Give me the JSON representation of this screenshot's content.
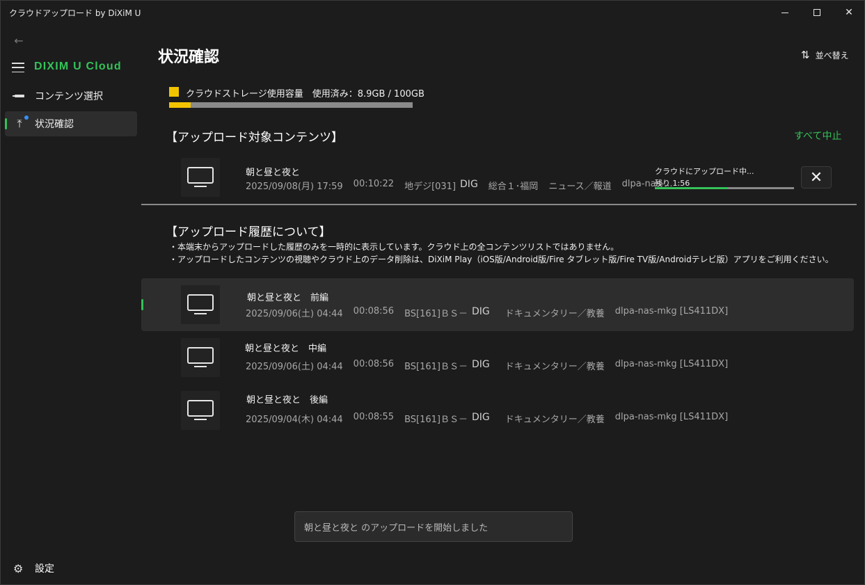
{
  "window": {
    "title": "クラウドアップロード by DiXiM U",
    "close_glyph": "✕"
  },
  "sidebar": {
    "back_glyph": "←",
    "brand": "DIXIM U Cloud",
    "items": [
      {
        "label": "コンテンツ選択",
        "icon": "cable-icon"
      },
      {
        "label": "状況確認",
        "icon": "upload-icon",
        "upload_glyph": "⤒"
      }
    ],
    "settings": {
      "label": "設定",
      "icon": "gear-icon",
      "glyph": "⚙"
    }
  },
  "header": {
    "title": "状況確認",
    "sort_label": "並べ替え",
    "sort_glyph": "⇅"
  },
  "storage": {
    "label": "クラウドストレージ使用容量　使用済み：8.9GB / 100GB",
    "used_gb": 8.9,
    "total_gb": 100,
    "color": "#f2c400"
  },
  "upload_section": {
    "heading": "【アップロード対象コンテンツ】",
    "stop_all_label": "すべて中止",
    "item": {
      "title": "朝と昼と夜と",
      "date": "2025/09/08(月) 17:59",
      "duration": "00:10:22",
      "channel": "地デジ[031]",
      "dig": "DIG",
      "station": "総合１･福岡",
      "genre": "ニュース／報道",
      "device": "dlpa-nas-...",
      "status": "クラウドにアップロード中...",
      "remaining": "残り 1:56",
      "progress": 0.52,
      "cancel_glyph": "✕"
    }
  },
  "history_section": {
    "heading": "【アップロード履歴について】",
    "notes": [
      "・本端末からアップロードした履歴のみを一時的に表示しています。クラウド上の全コンテンツリストではありません。",
      "・アップロードしたコンテンツの視聴やクラウド上のデータ削除は、DiXiM Play（iOS版/Android版/Fire タブレット版/Fire TV版/Androidテレビ版）アプリをご利用ください。"
    ],
    "items": [
      {
        "title": "朝と昼と夜と　前編",
        "date": "2025/09/06(土) 04:44",
        "duration": "00:08:56",
        "channel": "BS[161]ＢＳ－",
        "dig": "DIG",
        "genre": "ドキュメンタリー／教養",
        "device": "dlpa-nas-mkg [LS411DX]"
      },
      {
        "title": "朝と昼と夜と　中編",
        "date": "2025/09/06(土) 04:44",
        "duration": "00:08:56",
        "channel": "BS[161]ＢＳ－",
        "dig": "DIG",
        "genre": "ドキュメンタリー／教養",
        "device": "dlpa-nas-mkg [LS411DX]"
      },
      {
        "title": "朝と昼と夜と　後編",
        "date": "2025/09/04(木) 04:44",
        "duration": "00:08:55",
        "channel": "BS[161]ＢＳ－",
        "dig": "DIG",
        "genre": "ドキュメンタリー／教養",
        "device": "dlpa-nas-mkg [LS411DX]"
      }
    ]
  },
  "toast": {
    "message": "朝と昼と夜と のアップロードを開始しました"
  },
  "colors": {
    "accent": "#34c25a",
    "storage": "#f2c400",
    "badge": "#3a8ef6",
    "background": "#1c1c1c"
  }
}
